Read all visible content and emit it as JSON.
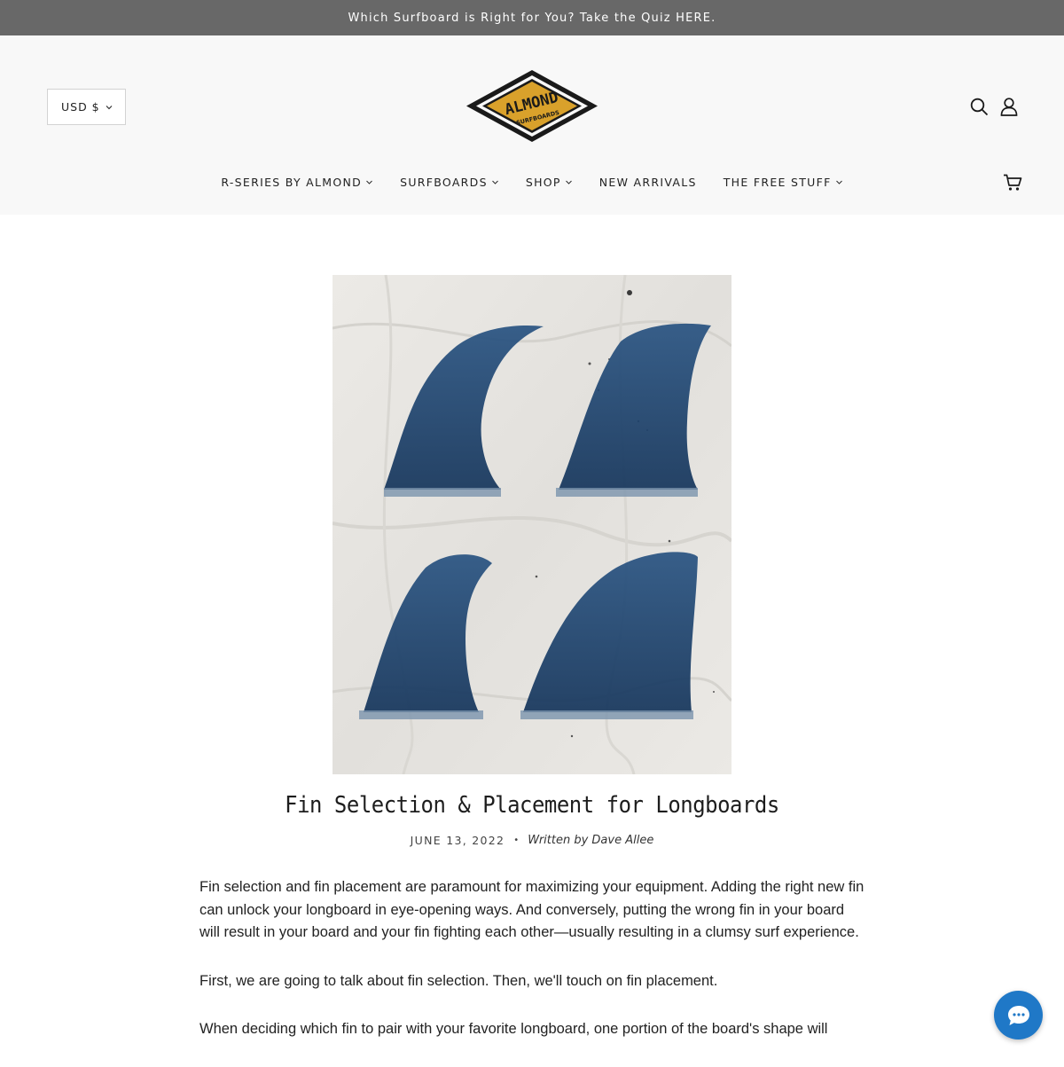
{
  "announcement": {
    "text": "Which Surfboard is Right for You? Take the Quiz HERE."
  },
  "header": {
    "currency": {
      "selected": "USD $"
    },
    "logo": {
      "brand": "ALMOND",
      "sub": "SURFBOARDS"
    },
    "icons": {
      "search": "search-icon",
      "account": "account-icon",
      "cart": "cart-icon"
    }
  },
  "nav": {
    "items": [
      {
        "label": "R-SERIES BY ALMOND",
        "dropdown": true
      },
      {
        "label": "SURFBOARDS",
        "dropdown": true
      },
      {
        "label": "SHOP",
        "dropdown": true
      },
      {
        "label": "NEW ARRIVALS",
        "dropdown": false
      },
      {
        "label": "THE FREE STUFF",
        "dropdown": true
      }
    ]
  },
  "article": {
    "title": "Fin Selection & Placement for Longboards",
    "date": "JUNE 13, 2022",
    "author": "Written by Dave Allee",
    "paragraphs": [
      "Fin selection and fin placement are paramount for maximizing your equipment.  Adding the right new fin can unlock your longboard in eye-opening ways.  And conversely, putting the wrong fin in your board will result in your board and your fin fighting each other—usually resulting in a clumsy surf experience.",
      "First, we are going to talk about fin selection.  Then, we'll touch on fin placement.",
      "When deciding which fin to pair with your favorite longboard, one portion of the board's shape will"
    ]
  },
  "colors": {
    "announce_bg": "#686868",
    "header_bg": "#f8f8f8",
    "logo_gold": "#d9a12b",
    "fin_blue": "#1c3f66",
    "chat_blue": "#1f78c7"
  }
}
